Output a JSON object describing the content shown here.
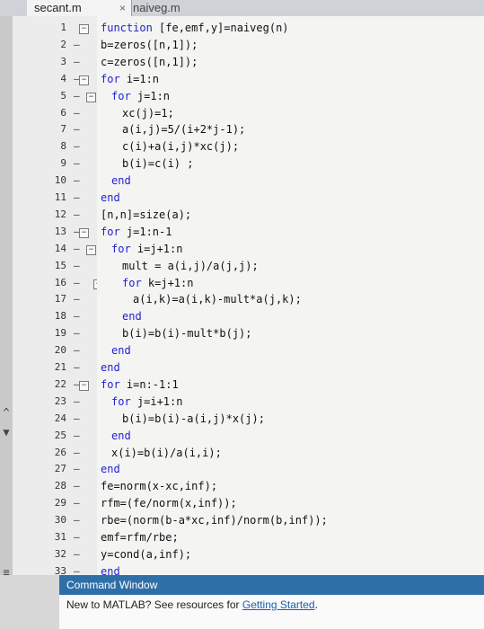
{
  "tabs": [
    {
      "label": "secant.m",
      "close": "×"
    },
    {
      "label": "naiveg.m"
    }
  ],
  "controls": [
    "^",
    "▼",
    "≡"
  ],
  "line_numbers": [
    "1",
    "2",
    "3",
    "4",
    "5",
    "6",
    "7",
    "8",
    "9",
    "10",
    "11",
    "12",
    "13",
    "14",
    "15",
    "16",
    "17",
    "18",
    "19",
    "20",
    "21",
    "22",
    "23",
    "24",
    "25",
    "26",
    "27",
    "28",
    "29",
    "30",
    "31",
    "32",
    "33"
  ],
  "code_lines": [
    "function [fe,emf,y]=naiveg(n)",
    "b=zeros([n,1]);",
    "c=zeros([n,1]);",
    "for i=1:n",
    "    for j=1:n",
    "        xc(j)=1;",
    "        a(i,j)=5/(i+2*j-1);",
    "        c(i)+a(i,j)*xc(j);",
    "        b(i)=c(i) ;",
    "    end",
    "end",
    "[n,n]=size(a);",
    "for j=1:n-1",
    "    for i=j+1:n",
    "        mult = a(i,j)/a(j,j);",
    "        for k=j+1:n",
    "            a(i,k)=a(i,k)-mult*a(j,k);",
    "        end",
    "        b(i)=b(i)-mult*b(j);",
    "    end",
    "end",
    "for i=n:-1:1",
    "    for j=i+1:n",
    "        b(i)=b(i)-a(i,j)*x(j);",
    "    end",
    "    x(i)=b(i)/a(i,i);",
    "end",
    "fe=norm(x-xc,inf);",
    "rfm=(fe/norm(x,inf));",
    "rbe=(norm(b-a*xc,inf)/norm(b,inf));",
    "emf=rfm/rbe;",
    "y=cond(a,inf);",
    "end"
  ],
  "command_window": {
    "title": "Command Window",
    "message_prefix": "New to MATLAB? See resources for ",
    "link_text": "Getting Started",
    "message_suffix": "."
  },
  "colors": {
    "keyword": "#1f1fd0",
    "command_header_bg": "#2f6fa8",
    "link": "#1a5fb4"
  }
}
